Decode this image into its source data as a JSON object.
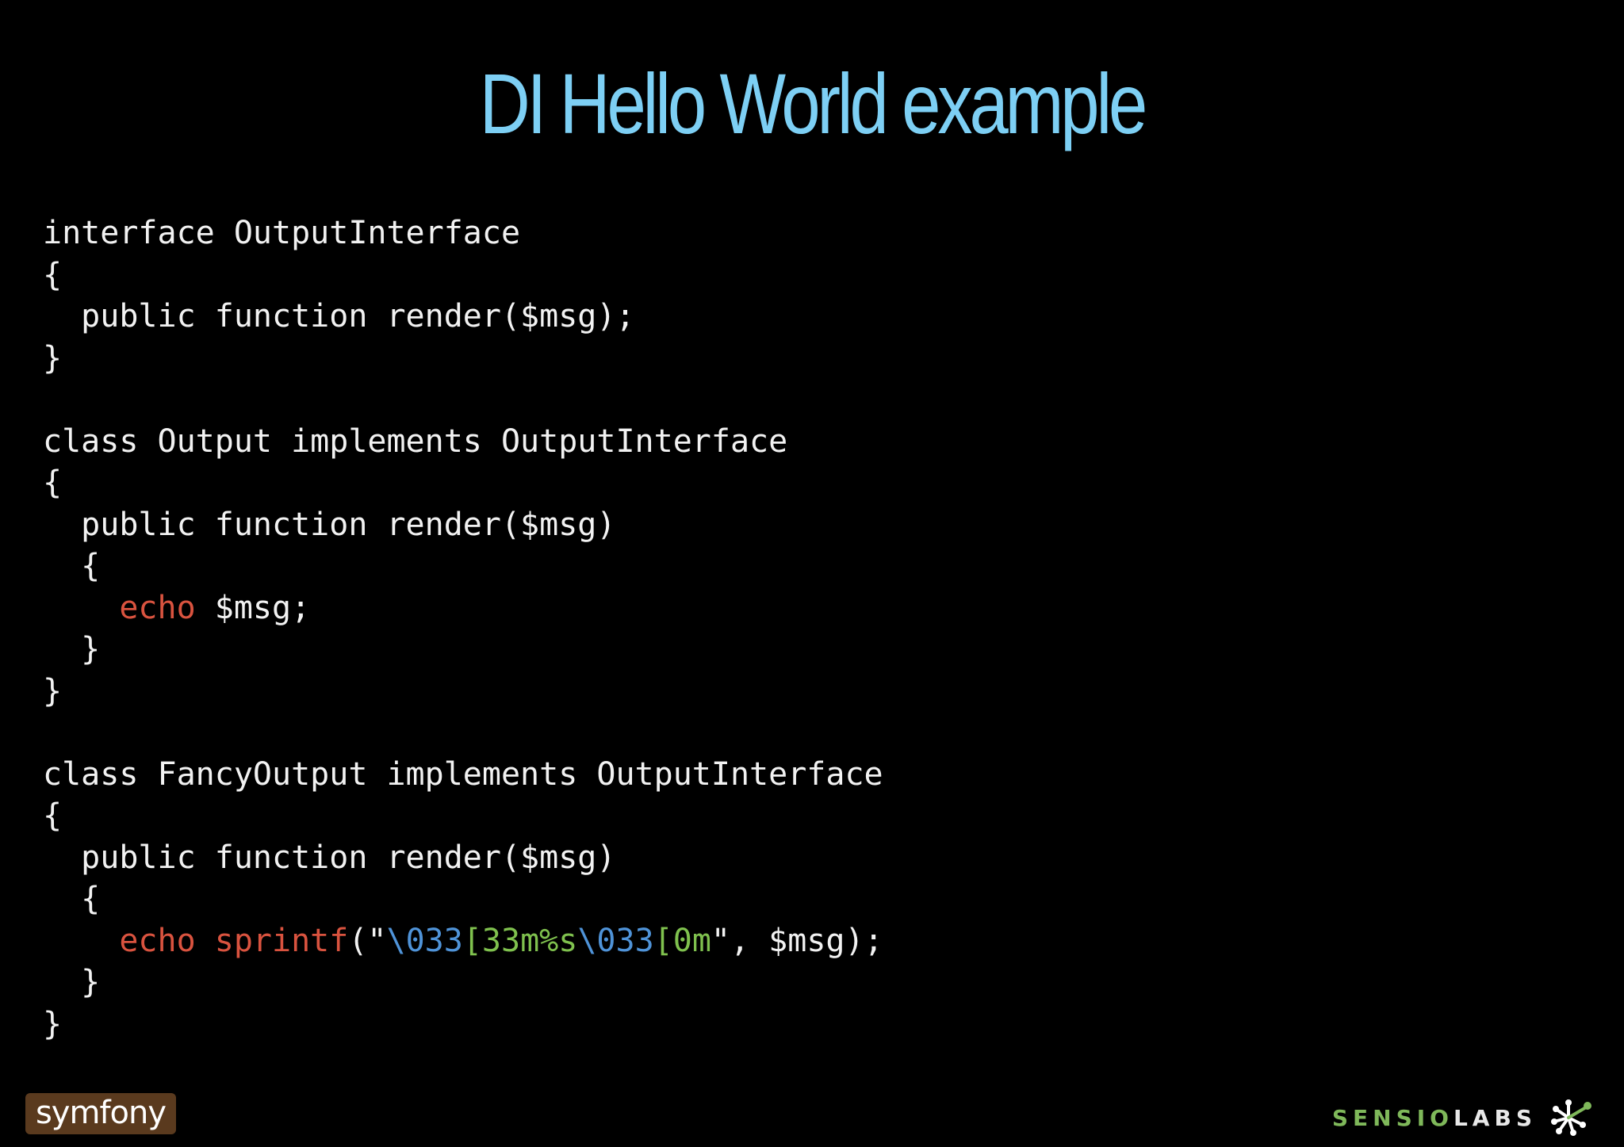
{
  "slide": {
    "title": "DI Hello World example"
  },
  "code": {
    "lines": [
      [
        {
          "t": "interface OutputInterface",
          "c": "plain"
        }
      ],
      [
        {
          "t": "{",
          "c": "plain"
        }
      ],
      [
        {
          "t": "  public function render($msg);",
          "c": "plain"
        }
      ],
      [
        {
          "t": "}",
          "c": "plain"
        }
      ],
      [
        {
          "t": "",
          "c": "plain"
        }
      ],
      [
        {
          "t": "class Output implements OutputInterface",
          "c": "plain"
        }
      ],
      [
        {
          "t": "{",
          "c": "plain"
        }
      ],
      [
        {
          "t": "  public function render($msg)",
          "c": "plain"
        }
      ],
      [
        {
          "t": "  {",
          "c": "plain"
        }
      ],
      [
        {
          "t": "    ",
          "c": "plain"
        },
        {
          "t": "echo",
          "c": "keyword"
        },
        {
          "t": " $msg;",
          "c": "plain"
        }
      ],
      [
        {
          "t": "  }",
          "c": "plain"
        }
      ],
      [
        {
          "t": "}",
          "c": "plain"
        }
      ],
      [
        {
          "t": "",
          "c": "plain"
        }
      ],
      [
        {
          "t": "class FancyOutput implements OutputInterface",
          "c": "plain"
        }
      ],
      [
        {
          "t": "{",
          "c": "plain"
        }
      ],
      [
        {
          "t": "  public function render($msg)",
          "c": "plain"
        }
      ],
      [
        {
          "t": "  {",
          "c": "plain"
        }
      ],
      [
        {
          "t": "    ",
          "c": "plain"
        },
        {
          "t": "echo",
          "c": "keyword"
        },
        {
          "t": " ",
          "c": "plain"
        },
        {
          "t": "sprintf",
          "c": "keyword"
        },
        {
          "t": "(\"",
          "c": "plain"
        },
        {
          "t": "\\033",
          "c": "esc"
        },
        {
          "t": "[33m%s",
          "c": "green"
        },
        {
          "t": "\\033",
          "c": "esc"
        },
        {
          "t": "[0m",
          "c": "green"
        },
        {
          "t": "\", $msg);",
          "c": "plain"
        }
      ],
      [
        {
          "t": "  }",
          "c": "plain"
        }
      ],
      [
        {
          "t": "}",
          "c": "plain"
        }
      ]
    ]
  },
  "footer": {
    "left_logo": "symfony",
    "right_logo_part1": "SENSIO",
    "right_logo_part2": "LABS",
    "right_icon": "sensiolabs-burst-icon"
  },
  "colors": {
    "background": "#000000",
    "title": "#7dcff4",
    "code_text": "#f2f2f2",
    "keyword": "#d9533f",
    "escape": "#4f93d8",
    "string_green": "#7fc14e"
  }
}
